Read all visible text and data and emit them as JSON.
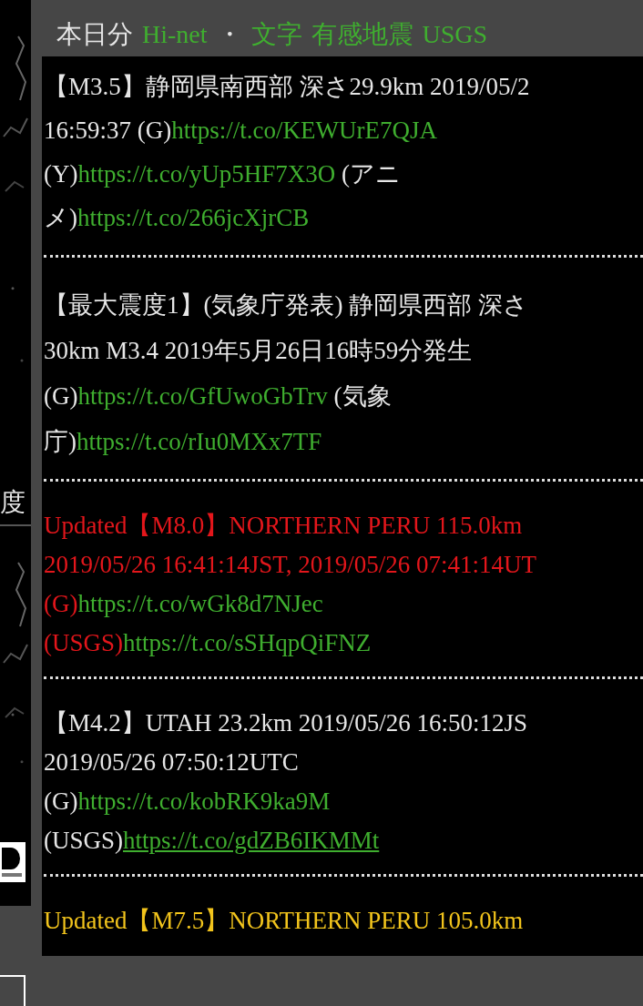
{
  "header": {
    "nav": [
      {
        "kind": "text",
        "text": "本日分"
      },
      {
        "kind": "link",
        "text": "Hi-net"
      },
      {
        "kind": "text",
        "text": "・"
      },
      {
        "kind": "link",
        "text": "文字"
      },
      {
        "kind": "link",
        "text": "有感地震"
      },
      {
        "kind": "link",
        "text": "USGS"
      }
    ]
  },
  "sidebar": {
    "label": "度"
  },
  "posts": [
    {
      "kind": "normal",
      "lines": [
        [
          {
            "kind": "text",
            "text": "【M3.5】静岡県南西部 深さ29.9km 2019/05/2"
          }
        ],
        [
          {
            "kind": "text",
            "text": "16:59:37 (G)"
          },
          {
            "kind": "link",
            "text": "https://t.co/KEWUrE7QJA",
            "underlined": false
          }
        ],
        [
          {
            "kind": "text",
            "text": "(Y)"
          },
          {
            "kind": "link",
            "text": "https://t.co/yUp5HF7X3O",
            "underlined": false
          },
          {
            "kind": "text",
            "text": " (アニ"
          }
        ],
        [
          {
            "kind": "text",
            "text": "メ)"
          },
          {
            "kind": "link",
            "text": "https://t.co/266jcXjrCB",
            "underlined": false
          }
        ]
      ]
    },
    {
      "kind": "normal",
      "lines": [
        [
          {
            "kind": "text",
            "text": "【最大震度1】(気象庁発表) 静岡県西部 深さ"
          }
        ],
        [
          {
            "kind": "text",
            "text": "30km M3.4 2019年5月26日16時59分発生"
          }
        ],
        [
          {
            "kind": "text",
            "text": "(G)"
          },
          {
            "kind": "link",
            "text": "https://t.co/GfUwoGbTrv",
            "underlined": false
          },
          {
            "kind": "text",
            "text": " (気象"
          }
        ],
        [
          {
            "kind": "text",
            "text": "庁)"
          },
          {
            "kind": "link",
            "text": "https://t.co/rIu0MXx7TF",
            "underlined": false
          }
        ]
      ]
    },
    {
      "kind": "major",
      "lines": [
        [
          {
            "kind": "text",
            "text": "Updated【M8.0】NORTHERN PERU 115.0km"
          }
        ],
        [
          {
            "kind": "text",
            "text": "2019/05/26 16:41:14JST, 2019/05/26 07:41:14UT"
          }
        ],
        [
          {
            "kind": "text",
            "text": "(G)"
          },
          {
            "kind": "link",
            "text": "https://t.co/wGk8d7NJec",
            "underlined": false
          }
        ],
        [
          {
            "kind": "text",
            "text": "(USGS)"
          },
          {
            "kind": "link",
            "text": "https://t.co/sSHqpQiFNZ",
            "underlined": false
          }
        ]
      ]
    },
    {
      "kind": "normal",
      "lines": [
        [
          {
            "kind": "text",
            "text": "【M4.2】UTAH 23.2km 2019/05/26 16:50:12JS"
          }
        ],
        [
          {
            "kind": "text",
            "text": "2019/05/26 07:50:12UTC"
          }
        ],
        [
          {
            "kind": "text",
            "text": "(G)"
          },
          {
            "kind": "link",
            "text": "https://t.co/kobRK9ka9M",
            "underlined": false
          }
        ],
        [
          {
            "kind": "text",
            "text": "(USGS)"
          },
          {
            "kind": "link",
            "text": "https://t.co/gdZB6IKMMt",
            "underlined": true
          }
        ]
      ]
    },
    {
      "kind": "update",
      "lines": [
        [
          {
            "kind": "text",
            "text": "Updated【M7.5】NORTHERN PERU 105.0km"
          }
        ]
      ]
    }
  ]
}
